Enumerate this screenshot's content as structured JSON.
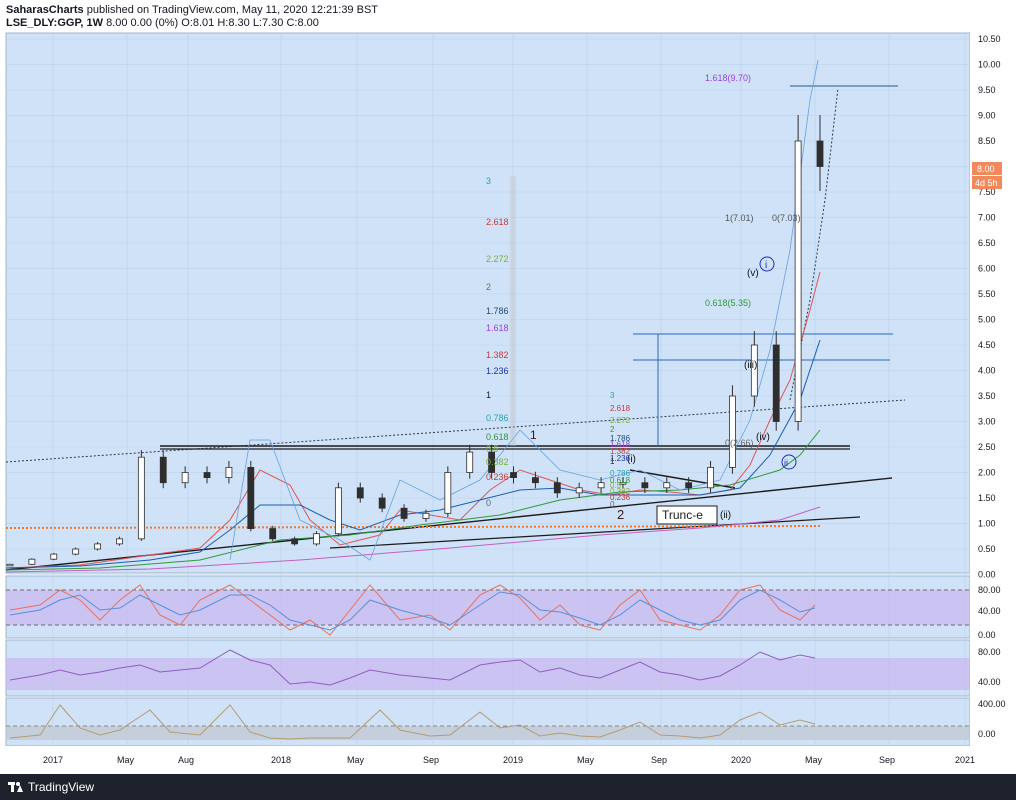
{
  "header": {
    "publisher": "SaharasCharts",
    "published_text": "published on TradingView.com, May 11, 2020 12:21:39 BST",
    "symbol": "LSE_DLY:GGP,",
    "interval": "1W",
    "ohlc_text": "8.00 0.00 (0%) O:8.01 H:8.30 L:7.30 C:8.00"
  },
  "footer": {
    "brand": "TradingView"
  },
  "colors": {
    "background": "#cfe2f7",
    "up_candle": "#2e2e2e",
    "price_badge": "#f08a5d",
    "fib_purple": "#9c3fd9",
    "wave_blue": "#1f2fb2",
    "rsi_band": "#c9b6f0"
  },
  "price_badge": {
    "price": "8.00",
    "countdown": "4d 5h"
  },
  "chart_data": {
    "type": "line",
    "title": "",
    "xlabel": "",
    "ylabel": "",
    "ylim": [
      0,
      10.5
    ],
    "y_ticks": [
      "10.50",
      "10.00",
      "9.50",
      "9.00",
      "8.50",
      "8.00",
      "7.50",
      "7.00",
      "6.50",
      "6.00",
      "5.50",
      "5.00",
      "4.50",
      "4.00",
      "3.50",
      "3.00",
      "2.50",
      "2.00",
      "1.50",
      "1.00",
      "0.50",
      "0.00"
    ],
    "x_ticks": [
      "2017",
      "May",
      "Aug",
      "2018",
      "May",
      "Sep",
      "2019",
      "May",
      "Sep",
      "2020",
      "May",
      "Sep",
      "2021"
    ],
    "grid": true,
    "price_series": {
      "name": "",
      "x": [
        "2016-12",
        "2017-01",
        "2017-03",
        "2017-05",
        "2017-06",
        "2017-08",
        "2017-09",
        "2017-10",
        "2017-11",
        "2017-12",
        "2018-01",
        "2018-02",
        "2018-03",
        "2018-05",
        "2018-06",
        "2018-07",
        "2018-08",
        "2018-09",
        "2018-10",
        "2018-11",
        "2018-12",
        "2019-01",
        "2019-02",
        "2019-03",
        "2019-04",
        "2019-05",
        "2019-06",
        "2019-07",
        "2019-08",
        "2019-09",
        "2019-10",
        "2019-11",
        "2019-12",
        "2020-01",
        "2020-02",
        "2020-03",
        "2020-04",
        "2020-05"
      ],
      "values": [
        0.2,
        0.3,
        0.4,
        0.5,
        0.6,
        0.7,
        2.3,
        1.8,
        2.0,
        1.9,
        2.1,
        0.9,
        0.7,
        0.6,
        0.8,
        1.7,
        1.5,
        1.3,
        1.1,
        1.2,
        2.0,
        2.4,
        2.0,
        1.9,
        1.8,
        1.6,
        1.7,
        1.8,
        1.8,
        1.7,
        1.8,
        1.7,
        2.1,
        3.5,
        4.5,
        3.0,
        8.5,
        8.0
      ]
    },
    "rsi_axis": [
      "80.00",
      "40.00",
      "0.00"
    ],
    "rsi2_axis": [
      "80.00",
      "40.00"
    ],
    "osc_axis": [
      "400.00",
      "0.00"
    ],
    "annotations": {
      "fib_top": "1.618(9.70)",
      "fib_1": "1(7.01)",
      "fib_0": "0(7.03)",
      "fib_0618": "0.618(5.35)",
      "fib_0266": "0(2.66)",
      "ext_levels": [
        "3",
        "2.618",
        "2.272",
        "2",
        "1.786",
        "1.618",
        "1.382",
        "1.236",
        "1",
        "0.786",
        "0.618",
        "0.5",
        "0.382",
        "0.236",
        "0"
      ],
      "ext_small": [
        "3",
        "2.618",
        "2.272",
        "2",
        "1.786",
        "1.618",
        "1.382",
        "1.236",
        "1",
        "0.786",
        "0.618",
        "0.5",
        "0.382",
        "0.236",
        "0"
      ],
      "wave_labels": [
        "1",
        "2",
        "(i)",
        "(ii)",
        "(iii)",
        "(iv)",
        "(v)",
        "i",
        "ii",
        "iv"
      ],
      "trunc_label": "Trunc-e"
    }
  }
}
